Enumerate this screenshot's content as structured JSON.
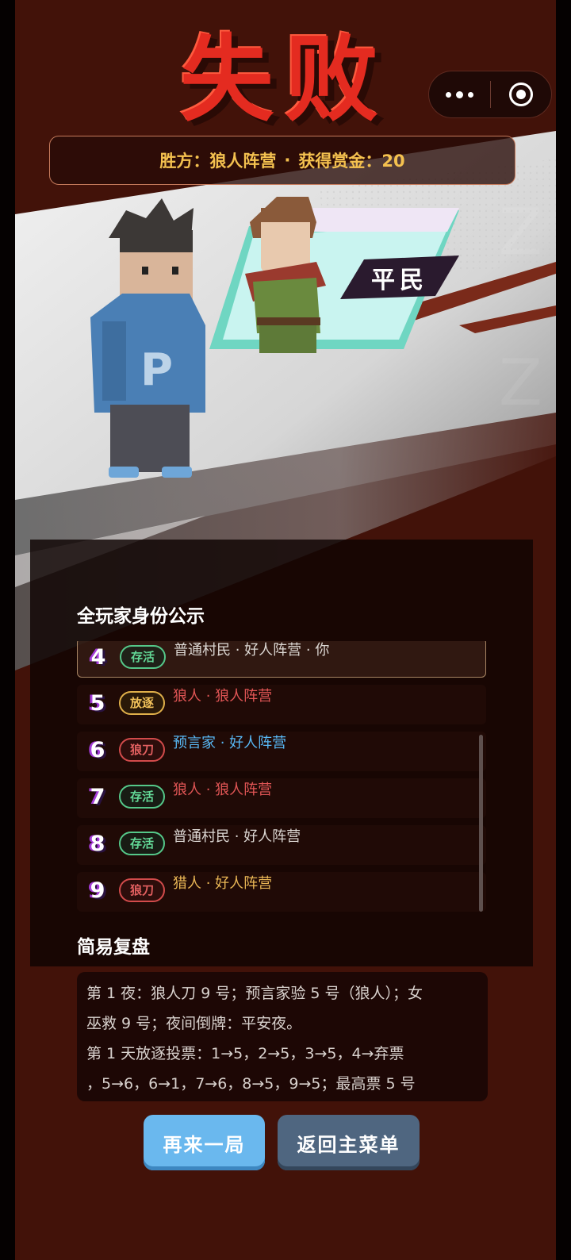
{
  "header": {
    "title": "失败",
    "result_winner_label": "胜方：狼人阵营",
    "result_separator": "·",
    "result_reward_label": "获得赏金：20"
  },
  "role": {
    "label": "平民"
  },
  "players_section": {
    "title": "全玩家身份公示",
    "rows": [
      {
        "number": "4",
        "status": "存活",
        "status_type": "alive",
        "description": "普通村民 · 好人阵营 · 你",
        "desc_color": "#dcd7d3",
        "is_self": true
      },
      {
        "number": "5",
        "status": "放逐",
        "status_type": "exiled",
        "description": "狼人 · 狼人阵营",
        "desc_color": "#e05555",
        "is_self": false
      },
      {
        "number": "6",
        "status": "狼刀",
        "status_type": "killed",
        "description": "预言家 · 好人阵营",
        "desc_color": "#58b8f5",
        "is_self": false
      },
      {
        "number": "7",
        "status": "存活",
        "status_type": "alive",
        "description": "狼人 · 狼人阵营",
        "desc_color": "#e05555",
        "is_self": false
      },
      {
        "number": "8",
        "status": "存活",
        "status_type": "alive",
        "description": "普通村民 · 好人阵营",
        "desc_color": "#dcd7d3",
        "is_self": false
      },
      {
        "number": "9",
        "status": "狼刀",
        "status_type": "killed",
        "description": "猎人 · 好人阵营",
        "desc_color": "#e9b655",
        "is_self": false
      }
    ]
  },
  "review_section": {
    "title": "简易复盘",
    "lines": [
      "第 1 夜：狼人刀 9 号；预言家验 5 号（狼人）；女",
      "巫救 9 号；夜间倒牌：平安夜。",
      "第 1 天放逐投票：1→5，2→5，3→5，4→弃票",
      "，5→6，6→1，7→6，8→5，9→5；最高票 5 号"
    ]
  },
  "buttons": {
    "replay": "再来一局",
    "main_menu": "返回主菜单"
  },
  "colors": {
    "background": "#421209",
    "title_red": "#e42b20",
    "reward_gold": "#f4c14f",
    "alive_green": "#55c889",
    "exiled_gold": "#e0b04a",
    "killed_red": "#d24b4b",
    "replay_blue": "#6ab8ee",
    "menu_slate": "#4f6680"
  }
}
